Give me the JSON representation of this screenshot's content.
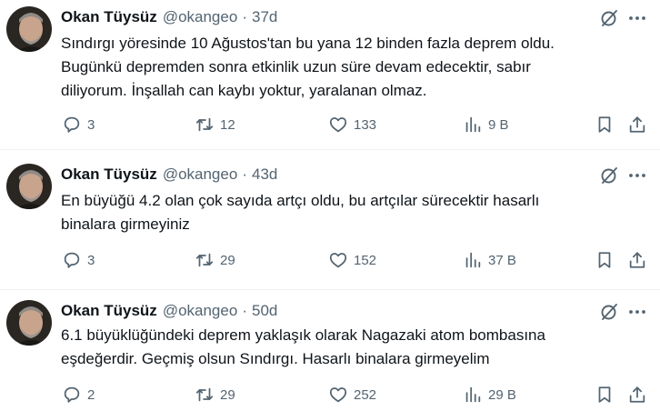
{
  "tweets": [
    {
      "name": "Okan Tüysüz",
      "handle": "@okangeo",
      "separator": "·",
      "time": "37d",
      "lines": [
        "Sındırgı yöresinde 10 Ağustos'tan bu yana 12 binden fazla deprem oldu.",
        "Bugünkü depremden sonra etkinlik uzun süre devam edecektir, sabır",
        "diliyorum. İnşallah can kaybı yoktur, yaralanan olmaz."
      ],
      "replies": "3",
      "retweets": "12",
      "likes": "133",
      "views": "9 B"
    },
    {
      "name": "Okan Tüysüz",
      "handle": "@okangeo",
      "separator": "·",
      "time": "43d",
      "lines": [
        "En büyüğü 4.2 olan çok sayıda artçı oldu, bu artçılar sürecektir hasarlı",
        "binalara girmeyiniz"
      ],
      "replies": "3",
      "retweets": "29",
      "likes": "152",
      "views": "37 B"
    },
    {
      "name": "Okan Tüysüz",
      "handle": "@okangeo",
      "separator": "·",
      "time": "50d",
      "lines": [
        "6.1 büyüklüğündeki deprem yaklaşık olarak Nagazaki atom bombasına",
        "eşdeğerdir. Geçmiş olsun Sındırgı. Hasarlı binalara girmeyelim"
      ],
      "replies": "2",
      "retweets": "29",
      "likes": "252",
      "views": "29 B"
    }
  ],
  "icons": {
    "reply": "reply-icon",
    "retweet": "retweet-icon",
    "like": "like-icon",
    "views": "views-icon",
    "bookmark": "bookmark-icon",
    "share": "share-icon",
    "grok": "grok-icon",
    "more": "more-icon"
  },
  "colors": {
    "text": "#0f1419",
    "secondary": "#536471",
    "divider": "#eff3f4",
    "background": "#ffffff"
  }
}
